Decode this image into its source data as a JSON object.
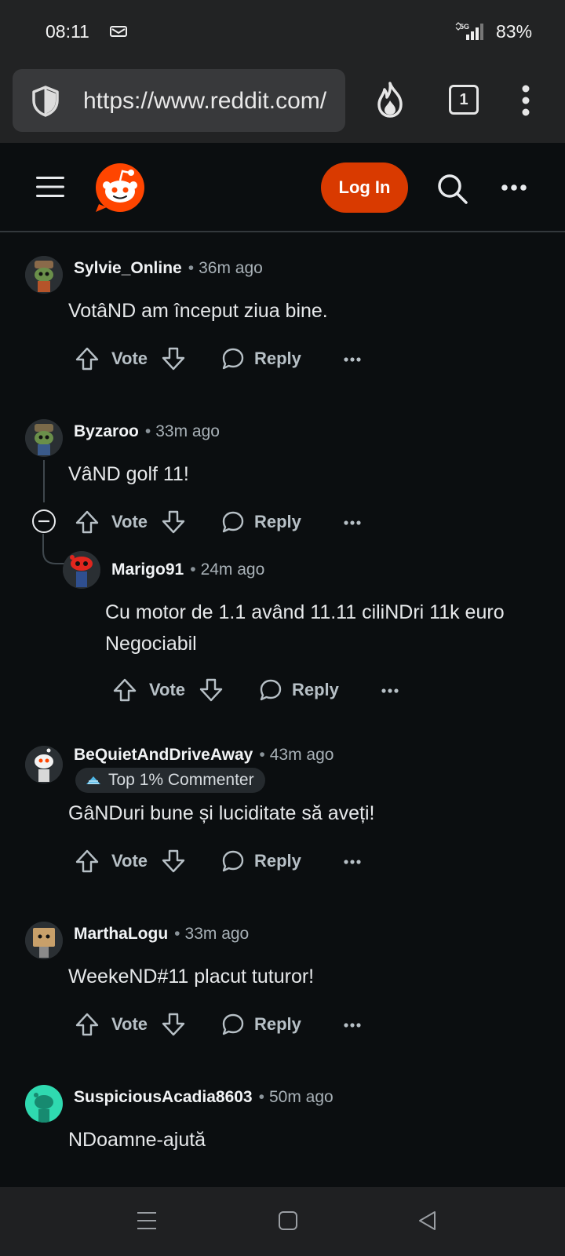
{
  "status_bar": {
    "time": "08:11",
    "network": "5G",
    "battery": "83%"
  },
  "browser": {
    "url": "https://www.reddit.com/",
    "tab_count": "1"
  },
  "header": {
    "login_label": "Log In",
    "accent_color": "#d93a00"
  },
  "actions": {
    "vote_label": "Vote",
    "reply_label": "Reply"
  },
  "comments": [
    {
      "username": "Sylvie_Online",
      "time": "36m ago",
      "text": "VotâND am început ziua bine."
    },
    {
      "username": "Byzaroo",
      "time": "33m ago",
      "text": "VâND golf 11!"
    },
    {
      "username": "Marigo91",
      "time": "24m ago",
      "text": "Cu motor de 1.1 având 11.11 ciliNDri 11k euro Negociabil"
    },
    {
      "username": "BeQuietAndDriveAway",
      "time": "43m ago",
      "badge": "Top 1% Commenter",
      "text": "GâNDuri bune și luciditate să aveți!"
    },
    {
      "username": "MarthaLogu",
      "time": "33m ago",
      "text": "WeekeND#11 placut tuturor!"
    },
    {
      "username": "SuspiciousAcadia8603",
      "time": "50m ago",
      "text": "NDoamne-ajută"
    }
  ]
}
